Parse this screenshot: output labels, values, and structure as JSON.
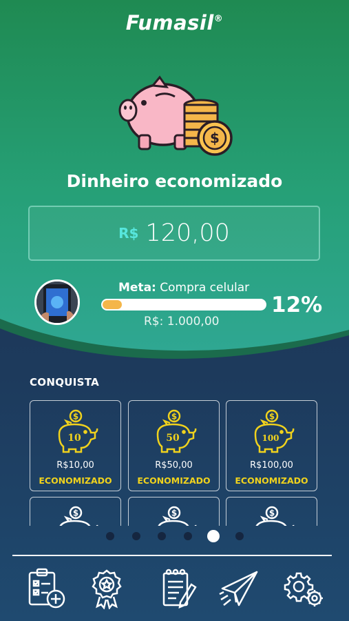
{
  "brand": {
    "name": "Fumasil",
    "mark": "®"
  },
  "hero": {
    "icon": "piggy-bank-with-coins-icon",
    "title": "Dinheiro economizado",
    "currency": "R$",
    "amount": "120,00"
  },
  "goal": {
    "label_prefix": "Meta:",
    "label": "Compra celular",
    "progress": 0.12,
    "percent_text": "12%",
    "target": "R$: 1.000,00"
  },
  "achievements": {
    "title": "CONQUISTA",
    "cards": [
      {
        "amount": "R$10,00",
        "status": "ECONOMIZADO",
        "badge": "10"
      },
      {
        "amount": "R$50,00",
        "status": "ECONOMIZADO",
        "badge": "50"
      },
      {
        "amount": "R$100,00",
        "status": "ECONOMIZADO",
        "badge": "100"
      },
      {
        "amount": "",
        "status": "",
        "badge": ""
      },
      {
        "amount": "",
        "status": "",
        "badge": ""
      },
      {
        "amount": "",
        "status": "",
        "badge": ""
      }
    ]
  },
  "pager": {
    "count": 6,
    "active_index": 4
  },
  "nav": [
    {
      "icon": "checklist-add-icon"
    },
    {
      "icon": "award-medal-icon"
    },
    {
      "icon": "notepad-pencil-icon"
    },
    {
      "icon": "paper-plane-icon"
    },
    {
      "icon": "settings-gears-icon"
    }
  ],
  "colors": {
    "accent": "#57e6dd",
    "gold": "#f0d21d",
    "progress": "#f4b64a",
    "hero_top": "#1f8a52",
    "hero_bottom": "#2fa792",
    "panel": "#1c3052"
  }
}
